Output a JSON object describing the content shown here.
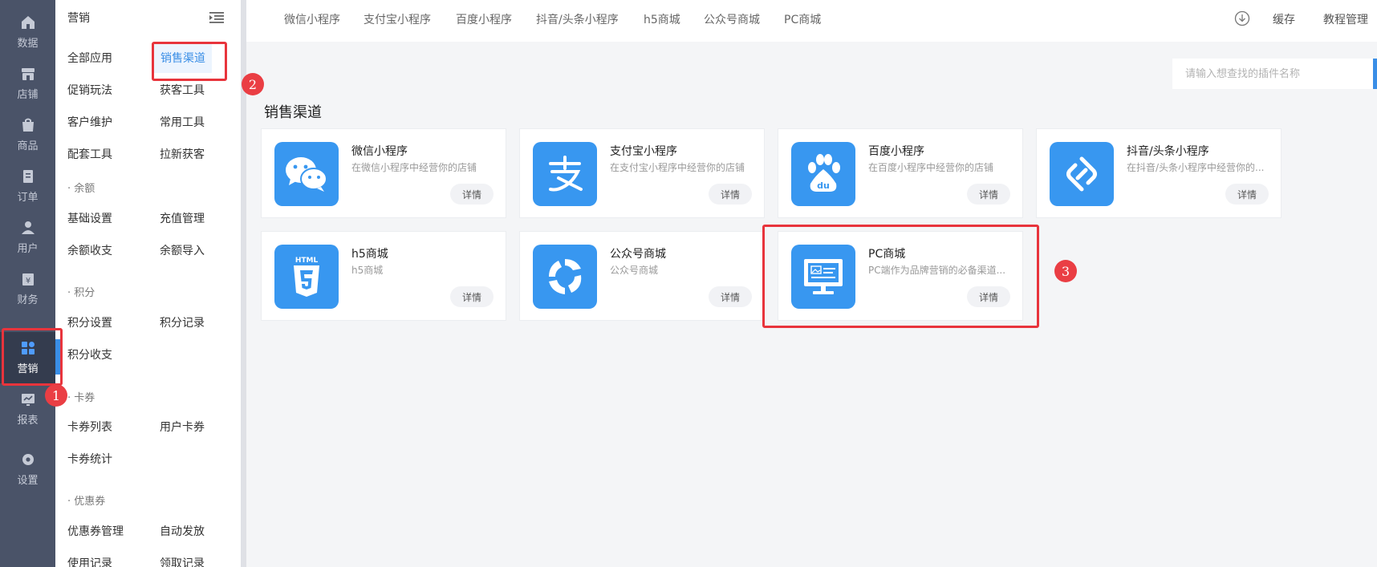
{
  "rail": {
    "items": [
      {
        "label": "数据",
        "icon": "home-icon"
      },
      {
        "label": "店铺",
        "icon": "store-icon"
      },
      {
        "label": "商品",
        "icon": "bag-icon"
      },
      {
        "label": "订单",
        "icon": "order-icon"
      },
      {
        "label": "用户",
        "icon": "user-icon"
      },
      {
        "label": "财务",
        "icon": "finance-icon"
      },
      {
        "label": "营销",
        "icon": "apps-icon"
      },
      {
        "label": "报表",
        "icon": "chart-icon"
      },
      {
        "label": "设置",
        "icon": "gear-icon"
      }
    ],
    "active": "营销"
  },
  "submenu": {
    "title": "营销",
    "items": {
      "all_apps": "全部应用",
      "sales_channel": "销售渠道",
      "promotion": "促销玩法",
      "acquire_tools": "获客工具",
      "customer_care": "客户维护",
      "common_tools": "常用工具",
      "support_tools": "配套工具",
      "new_customers": "拉新获客",
      "balance_group": "· 余额",
      "basic_settings": "基础设置",
      "recharge_mgmt": "充值管理",
      "balance_ledger": "余额收支",
      "balance_import": "余额导入",
      "points_group": "· 积分",
      "points_settings": "积分设置",
      "points_records": "积分记录",
      "points_ledger": "积分收支",
      "cards_group": "· 卡券",
      "card_list": "卡券列表",
      "user_cards": "用户卡券",
      "card_stats": "卡券统计",
      "coupon_group": "· 优惠券",
      "coupon_mgmt": "优惠券管理",
      "auto_issue": "自动发放",
      "usage_records": "使用记录",
      "claim_records": "领取记录"
    }
  },
  "topbar": {
    "nav": [
      "微信小程序",
      "支付宝小程序",
      "百度小程序",
      "抖音/头条小程序",
      "h5商城",
      "公众号商城",
      "PC商城"
    ],
    "cache": "缓存",
    "tutorial": "教程管理"
  },
  "search": {
    "placeholder": "请输入想查找的插件名称"
  },
  "section_title": "销售渠道",
  "cards": [
    {
      "title": "微信小程序",
      "desc": "在微信小程序中经营你的店铺",
      "btn": "详情",
      "icon": "wechat-icon"
    },
    {
      "title": "支付宝小程序",
      "desc": "在支付宝小程序中经营你的店铺",
      "btn": "详情",
      "icon": "alipay-icon"
    },
    {
      "title": "百度小程序",
      "desc": "在百度小程序中经营你的店铺",
      "btn": "详情",
      "icon": "baidu-icon"
    },
    {
      "title": "抖音/头条小程序",
      "desc": "在抖音/头条小程序中经营你的...",
      "btn": "详情",
      "icon": "douyin-icon"
    },
    {
      "title": "h5商城",
      "desc": "h5商城",
      "btn": "详情",
      "icon": "html5-icon"
    },
    {
      "title": "公众号商城",
      "desc": "公众号商城",
      "btn": "详情",
      "icon": "official-account-icon"
    },
    {
      "title": "PC商城",
      "desc": "PC端作为品牌营销的必备渠道...",
      "btn": "详情",
      "icon": "monitor-icon"
    }
  ],
  "annotations": {
    "badge1": "1",
    "badge2": "2",
    "badge3": "3"
  },
  "colors": {
    "accent": "#3a8ee6",
    "icon_bg": "#3897f0",
    "highlight": "#e8343c",
    "rail_bg": "#4a5368"
  }
}
